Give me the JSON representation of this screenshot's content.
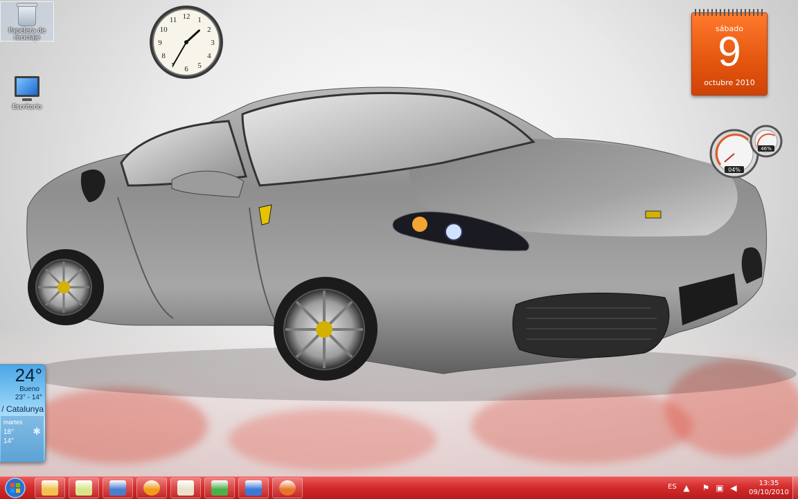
{
  "desktop": {
    "icons": [
      {
        "label": "Papelera de reciclaje",
        "icon": "recycle-bin-icon"
      },
      {
        "label": "Escritorio",
        "icon": "computer-icon"
      }
    ]
  },
  "gadgets": {
    "clock": {
      "hour": 1,
      "minute": 35,
      "numerals": [
        "12",
        "1",
        "2",
        "3",
        "4",
        "5",
        "6",
        "7",
        "8",
        "9",
        "10",
        "11"
      ]
    },
    "calendar": {
      "weekday": "sábado",
      "day": "9",
      "month_year": "octubre 2010"
    },
    "cpu_meter": {
      "cpu": "04%",
      "memory": "46%"
    },
    "weather": {
      "temp": "24°",
      "condition": "Bueno",
      "range": "23° - 14°",
      "location": "/ Catalunya",
      "forecast_day": "martes",
      "forecast_high": "18°",
      "forecast_low": "14°"
    }
  },
  "taskbar": {
    "start_icon": "windows-orb-icon",
    "pinned": [
      {
        "name": "explorer",
        "icon": "folder-icon",
        "color": "#f2c14e"
      },
      {
        "name": "sticky-notes",
        "icon": "sticky-note-icon",
        "color": "#d9e58a"
      },
      {
        "name": "documents",
        "icon": "documents-icon",
        "color": "#4a7fd0"
      },
      {
        "name": "messenger-app",
        "icon": "orange-circle-icon",
        "color": "#f29a1a"
      },
      {
        "name": "paint",
        "icon": "palette-icon",
        "color": "#e8e0c8"
      },
      {
        "name": "messenger",
        "icon": "people-icon",
        "color": "#4ab04a"
      },
      {
        "name": "remote-desktop",
        "icon": "monitor-icon",
        "color": "#3a78d8"
      },
      {
        "name": "firefox",
        "icon": "firefox-icon",
        "color": "#e8742a"
      }
    ],
    "tray": {
      "language": "ES",
      "time": "13:35",
      "date": "09/10/2010"
    }
  }
}
